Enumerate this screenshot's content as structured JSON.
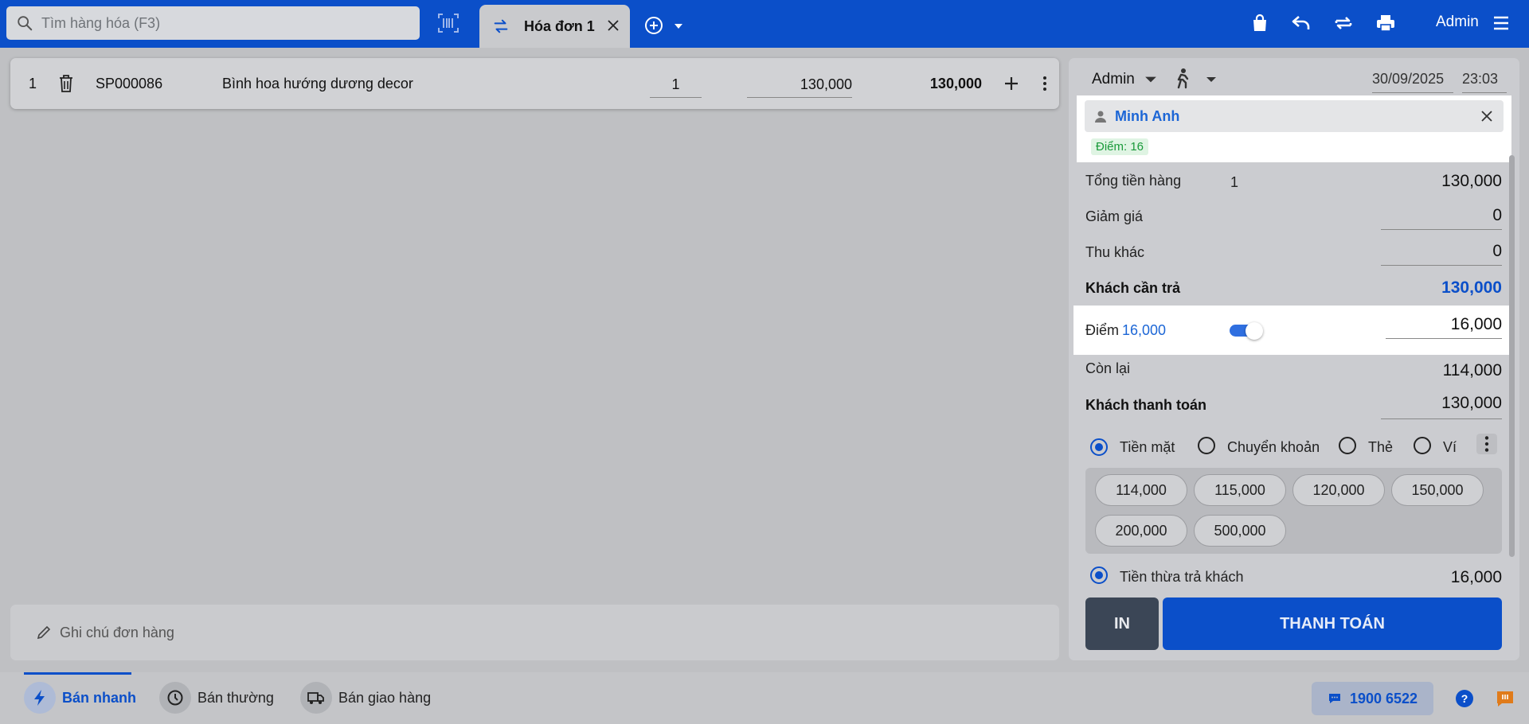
{
  "header": {
    "search_placeholder": "Tìm hàng hóa (F3)",
    "tab_label": "Hóa đơn 1",
    "user": "Admin"
  },
  "cart": {
    "items": [
      {
        "index": "1",
        "code": "SP000086",
        "name": "Bình hoa hướng dương decor",
        "qty": "1",
        "price": "130,000",
        "total": "130,000"
      }
    ]
  },
  "note": {
    "placeholder": "Ghi chú đơn hàng"
  },
  "panel": {
    "seller": "Admin",
    "date": "30/09/2025",
    "time": "23:03",
    "customer": {
      "name": "Minh Anh",
      "points_badge": "Điểm: 16"
    },
    "subtotal": {
      "label": "Tổng tiền hàng",
      "count": "1",
      "value": "130,000"
    },
    "discount": {
      "label": "Giảm giá",
      "value": "0"
    },
    "other_fee": {
      "label": "Thu khác",
      "value": "0"
    },
    "to_pay": {
      "label": "Khách cần trả",
      "value": "130,000"
    },
    "points": {
      "label": "Điểm",
      "available": "16,000",
      "value": "16,000",
      "enabled": true
    },
    "remaining": {
      "label": "Còn lại",
      "value": "114,000"
    },
    "customer_pays": {
      "label": "Khách thanh toán",
      "value": "130,000"
    },
    "methods": [
      "Tiền mặt",
      "Chuyển khoản",
      "Thẻ",
      "Ví"
    ],
    "selected_method": "Tiền mặt",
    "quick_amounts": [
      "114,000",
      "115,000",
      "120,000",
      "150,000",
      "200,000",
      "500,000"
    ],
    "change": {
      "label": "Tiền thừa trả khách",
      "value": "16,000"
    },
    "print_label": "IN",
    "pay_label": "THANH TOÁN"
  },
  "bottom": {
    "items": [
      "Bán nhanh",
      "Bán thường",
      "Bán giao hàng"
    ],
    "active": "Bán nhanh",
    "hotline": "1900 6522"
  },
  "colors": {
    "brand": "#0b4fc9",
    "link": "#1c66d6",
    "points_green": "#1a9a3a"
  }
}
